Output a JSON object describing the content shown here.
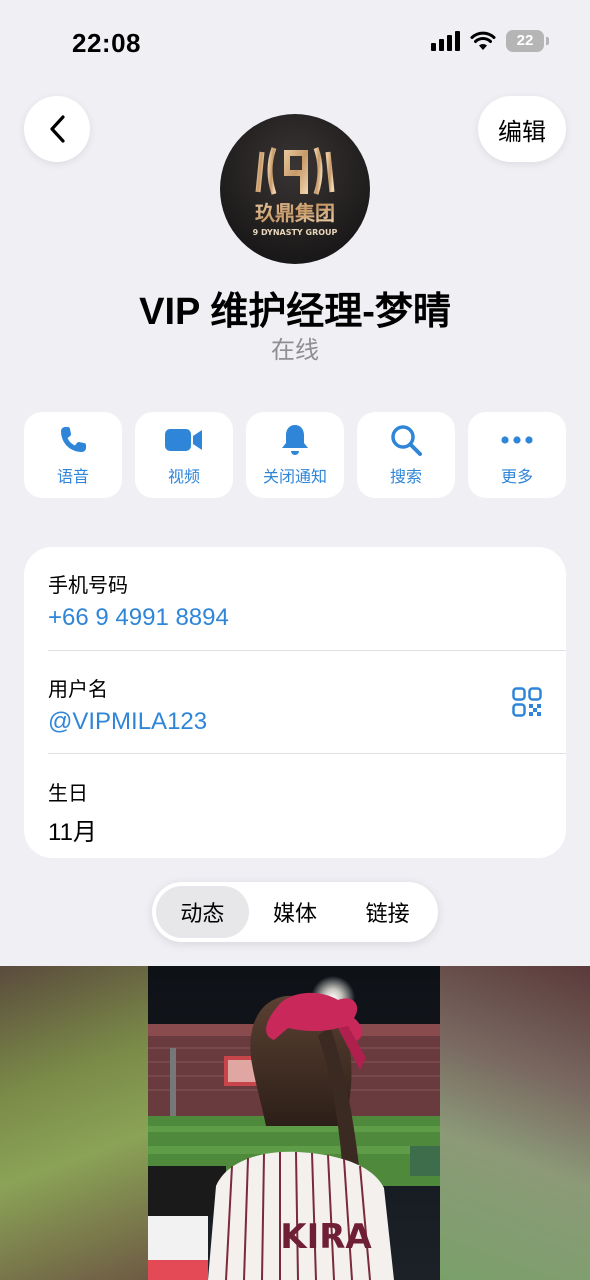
{
  "status": {
    "time": "22:08",
    "battery": "22"
  },
  "header": {
    "edit_label": "编辑"
  },
  "avatar": {
    "logo_text": "玖鼎集团",
    "logo_sub": "9 DYNASTY GROUP"
  },
  "profile": {
    "name": "VIP 维护经理-梦晴",
    "presence": "在线"
  },
  "actions": [
    {
      "label": "语音",
      "icon": "phone-icon"
    },
    {
      "label": "视频",
      "icon": "video-icon"
    },
    {
      "label": "关闭通知",
      "icon": "bell-icon"
    },
    {
      "label": "搜索",
      "icon": "search-icon"
    },
    {
      "label": "更多",
      "icon": "more-icon"
    }
  ],
  "info": {
    "phone_title": "手机号码",
    "phone_value": "+66 9 4991 8894",
    "username_title": "用户名",
    "username_value": "@VIPMILA123",
    "birthday_title": "生日",
    "birthday_value": "11月"
  },
  "tabs": [
    {
      "label": "动态",
      "active": true
    },
    {
      "label": "媒体",
      "active": false
    },
    {
      "label": "链接",
      "active": false
    }
  ],
  "media": {
    "jersey_text": "KIRA"
  },
  "colors": {
    "accent": "#2f86d8",
    "background": "#efeff4"
  }
}
